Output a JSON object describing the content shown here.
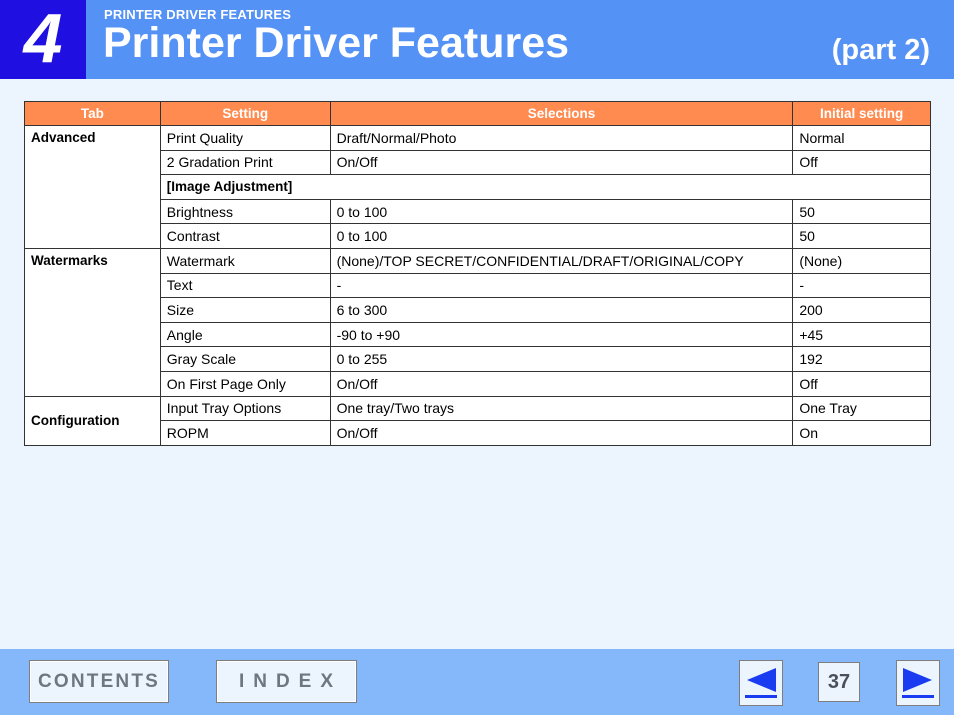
{
  "header": {
    "chapter_number": "4",
    "section_label": "PRINTER DRIVER FEATURES",
    "title": "Printer Driver Features",
    "part_label": "(part 2)"
  },
  "table": {
    "columns": [
      "Tab",
      "Setting",
      "Selections",
      "Initial setting"
    ],
    "groups": [
      {
        "tab": "Advanced",
        "rows": [
          [
            "Print Quality",
            "Draft/Normal/Photo",
            "Normal"
          ],
          [
            "2 Gradation Print",
            "On/Off",
            "Off"
          ]
        ],
        "subgroup": "[Image Adjustment]",
        "subrows": [
          [
            "Brightness",
            "0 to 100",
            "50"
          ],
          [
            "Contrast",
            "0 to 100",
            "50"
          ]
        ]
      },
      {
        "tab": "Watermarks",
        "rows": [
          [
            "Watermark",
            "(None)/TOP SECRET/CONFIDENTIAL/DRAFT/ORIGINAL/COPY",
            "(None)"
          ],
          [
            "Text",
            "-",
            "-"
          ],
          [
            "Size",
            "6 to 300",
            "200"
          ],
          [
            "Angle",
            "-90 to +90",
            "+45"
          ],
          [
            "Gray Scale",
            "0 to 255",
            "192"
          ],
          [
            "On First Page Only",
            "On/Off",
            "Off"
          ]
        ]
      },
      {
        "tab": "Configuration",
        "rows": [
          [
            "Input Tray Options",
            "One tray/Two trays",
            "One Tray"
          ],
          [
            "ROPM",
            "On/Off",
            "On"
          ]
        ]
      }
    ]
  },
  "footer": {
    "contents_label": "CONTENTS",
    "index_label": "INDEX",
    "page_number": "37",
    "prev_icon": "left-arrow-icon",
    "next_icon": "right-arrow-icon"
  },
  "colors": {
    "header_bg": "#5592f5",
    "chapter_box": "#1f0fe0",
    "table_header": "#ff8b50",
    "footer_bg": "#85b8fb",
    "arrow_blue": "#1a3cf0"
  }
}
